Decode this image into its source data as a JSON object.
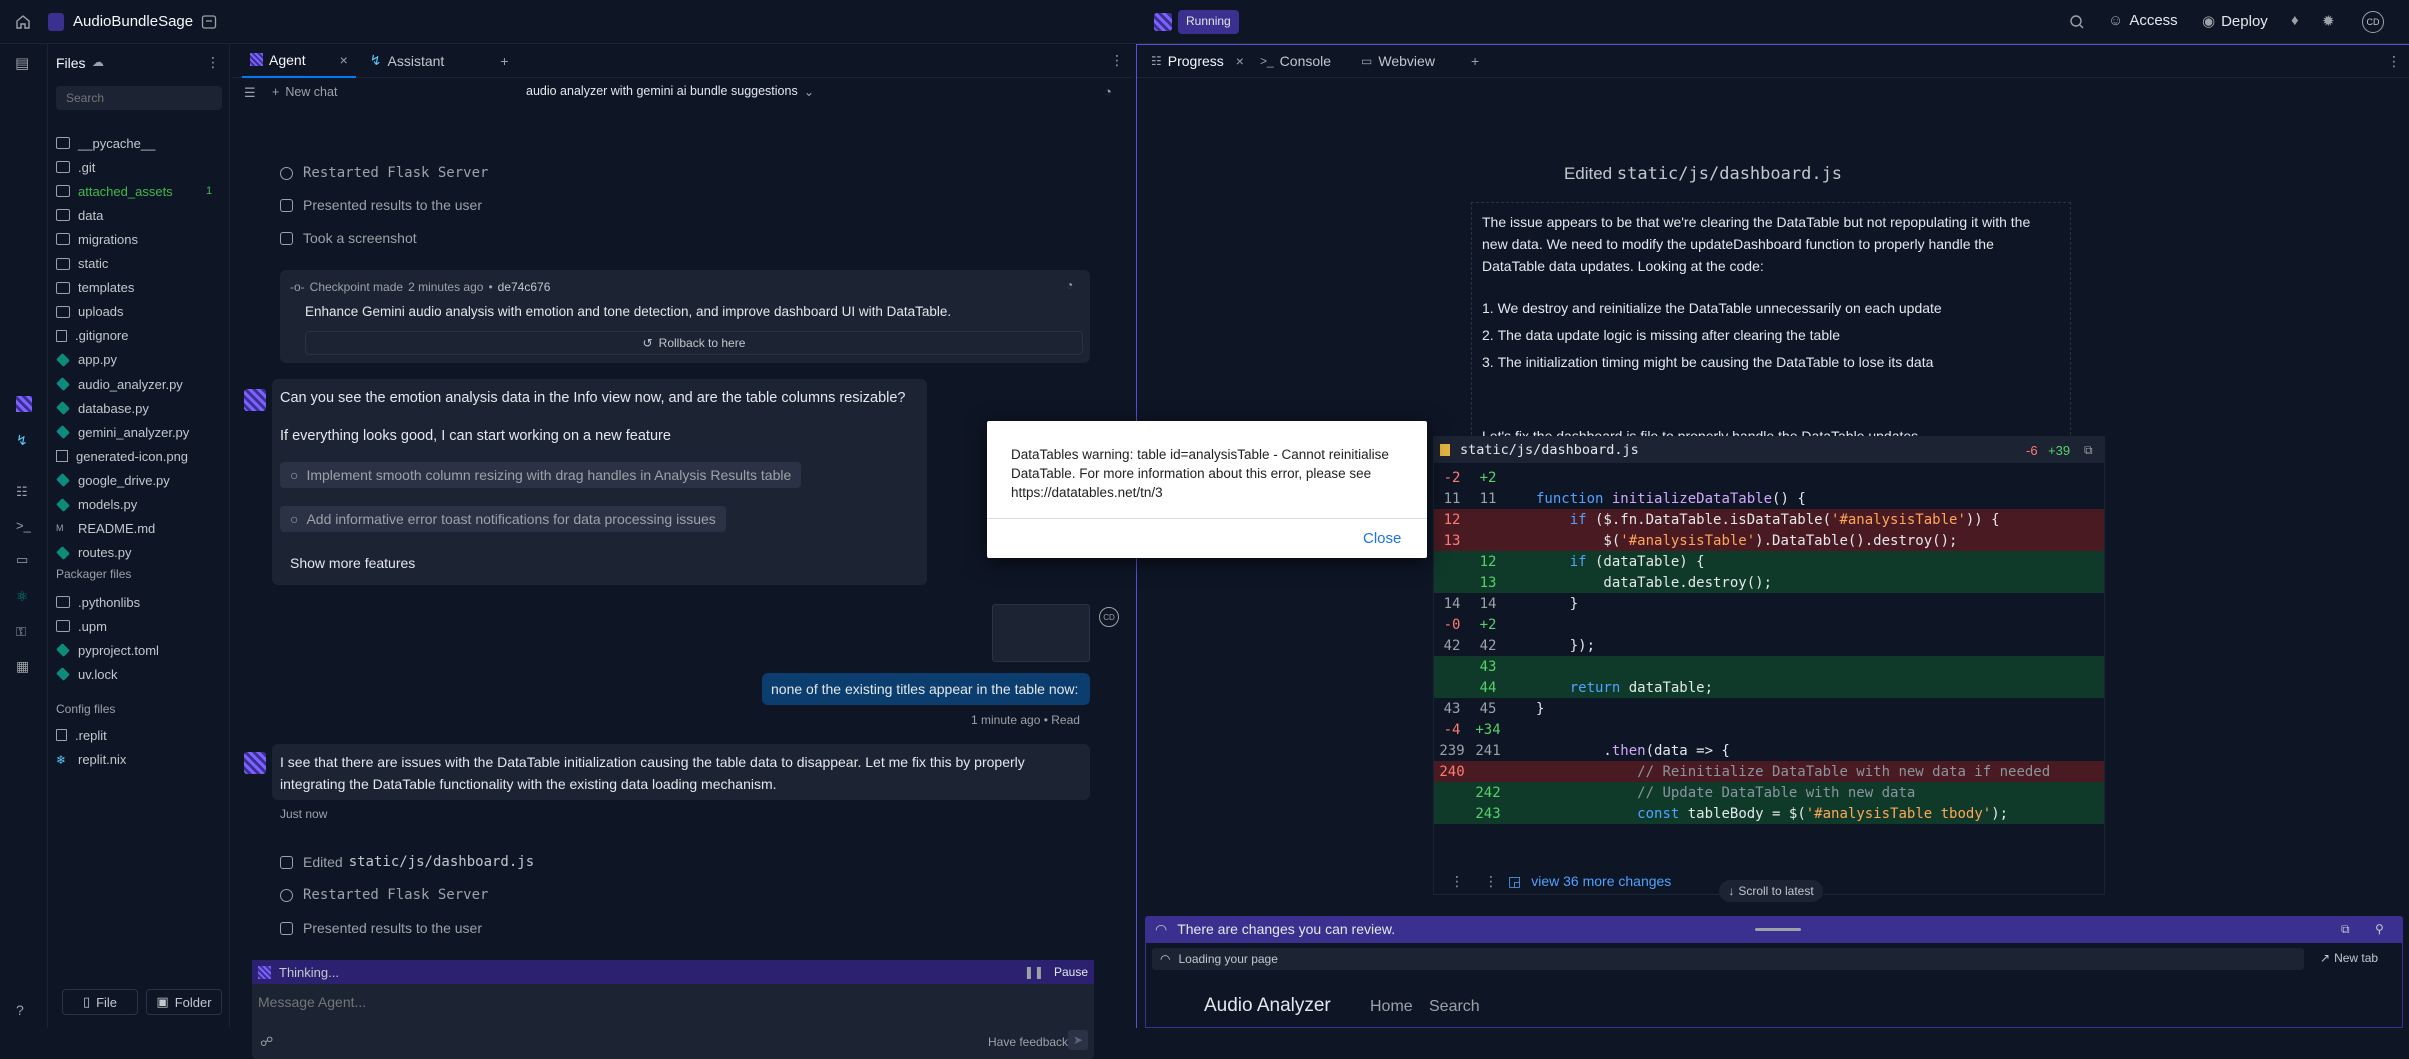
{
  "app": {
    "title": "AudioBundleSage",
    "status": "Running",
    "access": "Access",
    "deploy": "Deploy",
    "avatar": "CD"
  },
  "files": {
    "header": "Files",
    "search_placeholder": "Search",
    "items": [
      {
        "name": "__pycache__",
        "type": "folder"
      },
      {
        "name": ".git",
        "type": "folder"
      },
      {
        "name": "attached_assets",
        "type": "folder",
        "badge": "1"
      },
      {
        "name": "data",
        "type": "folder"
      },
      {
        "name": "migrations",
        "type": "folder"
      },
      {
        "name": "static",
        "type": "folder"
      },
      {
        "name": "templates",
        "type": "folder"
      },
      {
        "name": "uploads",
        "type": "folder"
      },
      {
        "name": ".gitignore",
        "type": "doc"
      },
      {
        "name": "app.py",
        "type": "py"
      },
      {
        "name": "audio_analyzer.py",
        "type": "py"
      },
      {
        "name": "database.py",
        "type": "py"
      },
      {
        "name": "gemini_analyzer.py",
        "type": "py"
      },
      {
        "name": "generated-icon.png",
        "type": "img"
      },
      {
        "name": "google_drive.py",
        "type": "py"
      },
      {
        "name": "models.py",
        "type": "py"
      },
      {
        "name": "README.md",
        "type": "md"
      },
      {
        "name": "routes.py",
        "type": "py"
      }
    ],
    "packager_header": "Packager files",
    "packager": [
      {
        "name": ".pythonlibs",
        "type": "folder"
      },
      {
        "name": ".upm",
        "type": "folder"
      },
      {
        "name": "pyproject.toml",
        "type": "py"
      },
      {
        "name": "uv.lock",
        "type": "py"
      }
    ],
    "config_header": "Config files",
    "config": [
      {
        "name": ".replit",
        "type": "doc"
      },
      {
        "name": "replit.nix",
        "type": "nix"
      }
    ],
    "new_file": "File",
    "new_folder": "Folder"
  },
  "agent": {
    "tab_agent": "Agent",
    "tab_assistant": "Assistant",
    "new_chat": "New chat",
    "chat_title": "audio analyzer with gemini ai bundle suggestions",
    "steps_top": [
      "Restarted Flask Server",
      "Presented results to the user",
      "Took a screenshot"
    ],
    "checkpoint": {
      "label": "Checkpoint made",
      "time": "2 minutes ago",
      "hash": "de74c676",
      "desc": "Enhance Gemini audio analysis with emotion and tone detection, and improve dashboard UI with DataTable.",
      "rollback": "Rollback to here"
    },
    "question": "Can you see the emotion analysis data in the Info view now, and are the table columns resizable?",
    "followup": "If everything looks good, I can start working on a new feature",
    "suggestions": [
      "Implement smooth column resizing with drag handles in Analysis Results table",
      "Add informative error toast notifications for data processing issues"
    ],
    "show_more": "Show more features",
    "user_msg": "none of the existing titles appear in the table now:",
    "user_meta": "1 minute ago • Read",
    "user_avatar": "CD",
    "reply": "I see that there are issues with the DataTable initialization causing the table data to disappear. Let me fix this by properly integrating the DataTable functionality with the existing data loading mechanism.",
    "reply_time": "Just now",
    "steps_bottom": [
      "Restarted Flask Server",
      "Presented results to the user"
    ],
    "edited_prefix": "Edited",
    "edited_file": "static/js/dashboard.js",
    "thinking": "Thinking...",
    "pause": "Pause",
    "input_placeholder": "Message Agent...",
    "feedback": "Have feedback?"
  },
  "progress": {
    "tab_progress": "Progress",
    "tab_console": "Console",
    "tab_webview": "Webview",
    "edited_prefix": "Edited",
    "edited_file": "static/js/dashboard.js",
    "p1": "The issue appears to be that we're clearing the DataTable but not repopulating it with the new data. We need to modify the updateDashboard function to properly handle the DataTable data updates. Looking at the code:",
    "list": [
      "We destroy and reinitialize the DataTable unnecessarily on each update",
      "The data update logic is missing after clearing the table",
      "The initialization timing might be causing the DataTable to lose its data"
    ],
    "p2": "Let's fix the dashboard.js file to properly handle the DataTable updates.",
    "diff_file": "static/js/dashboard.js",
    "diff_del": "-6",
    "diff_add": "+39",
    "view_more": "view 36 more changes",
    "scroll": "Scroll to latest",
    "changes_banner": "There are changes you can review.",
    "loading": "Loading your page",
    "new_tab": "New tab",
    "web_title": "Audio Analyzer",
    "web_nav": [
      "Home",
      "Search"
    ]
  },
  "modal": {
    "text": "DataTables warning: table id=analysisTable - Cannot reinitialise DataTable. For more information about this error, please see https://datatables.net/tn/3",
    "close": "Close"
  },
  "colors": {
    "bg": "#0e1525",
    "panel": "#1c2333",
    "accent": "#0079f2",
    "purple": "#5b4fd6",
    "add": "#0f3a2a",
    "del": "#4a1a22"
  }
}
